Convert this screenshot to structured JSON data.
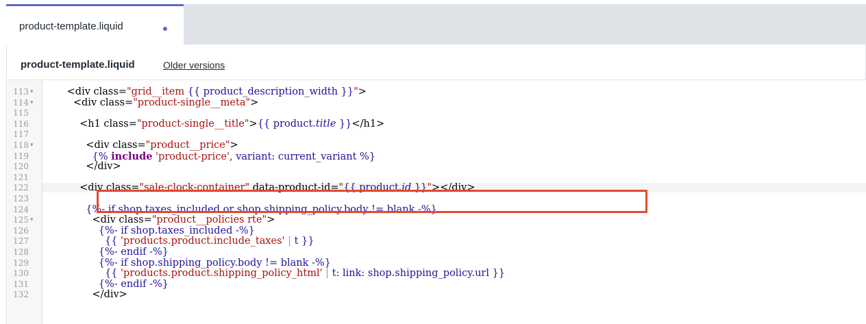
{
  "tabs": [
    {
      "label": "product-template.liquid",
      "modified": true
    }
  ],
  "file_header": {
    "file_name": "product-template.liquid",
    "older_versions_label": "Older versions"
  },
  "editor": {
    "lines": [
      {
        "n": "113",
        "fold": "▾",
        "tokens": [
          [
            "plain",
            "      <div "
          ],
          [
            "attr",
            "class="
          ],
          [
            "str",
            "\"grid__item "
          ],
          [
            "liq",
            "{{ product_description_width }}"
          ],
          [
            "str",
            "\""
          ],
          [
            "plain",
            ">"
          ]
        ]
      },
      {
        "n": "114",
        "fold": "▾",
        "tokens": [
          [
            "plain",
            "        <div "
          ],
          [
            "attr",
            "class="
          ],
          [
            "str",
            "\"product-single__meta\""
          ],
          [
            "plain",
            ">"
          ]
        ]
      },
      {
        "n": "115",
        "fold": "",
        "tokens": []
      },
      {
        "n": "116",
        "fold": "",
        "tokens": [
          [
            "plain",
            "          <h1 "
          ],
          [
            "attr",
            "class="
          ],
          [
            "str",
            "\"product-single__title\""
          ],
          [
            "plain",
            ">"
          ],
          [
            "liq",
            "{{ product."
          ],
          [
            "prop",
            "title"
          ],
          [
            "liq",
            " }}"
          ],
          [
            "plain",
            "</h1>"
          ]
        ]
      },
      {
        "n": "117",
        "fold": "",
        "tokens": []
      },
      {
        "n": "118",
        "fold": "▾",
        "tokens": [
          [
            "plain",
            "            <div "
          ],
          [
            "attr",
            "class="
          ],
          [
            "str",
            "\"product__price\""
          ],
          [
            "plain",
            ">"
          ]
        ]
      },
      {
        "n": "119",
        "fold": "",
        "tokens": [
          [
            "liq",
            "              {% "
          ],
          [
            "kw",
            "include"
          ],
          [
            "str",
            " 'product-price'"
          ],
          [
            "liq",
            ", variant: current_variant %}"
          ]
        ]
      },
      {
        "n": "120",
        "fold": "",
        "tokens": [
          [
            "plain",
            "            </div>"
          ]
        ]
      },
      {
        "n": "121",
        "fold": "",
        "tokens": []
      },
      {
        "n": "122",
        "fold": "",
        "tokens": [
          [
            "plain",
            "          <div "
          ],
          [
            "attr",
            "class="
          ],
          [
            "str",
            "\"sale-clock-container\""
          ],
          [
            "attr",
            " data-product-id="
          ],
          [
            "str",
            "\""
          ],
          [
            "liq",
            "{{ product."
          ],
          [
            "prop",
            "id"
          ],
          [
            "liq",
            " }}"
          ],
          [
            "str",
            "\""
          ],
          [
            "plain",
            "></div>"
          ]
        ]
      },
      {
        "n": "123",
        "fold": "",
        "tokens": []
      },
      {
        "n": "124",
        "fold": "",
        "tokens": [
          [
            "liq",
            "            {%- if shop.taxes_included or shop.shipping_policy.body != blank -%}"
          ]
        ]
      },
      {
        "n": "125",
        "fold": "▾",
        "tokens": [
          [
            "plain",
            "              <div "
          ],
          [
            "attr",
            "class="
          ],
          [
            "str",
            "\"product__policies rte\""
          ],
          [
            "plain",
            ">"
          ]
        ]
      },
      {
        "n": "126",
        "fold": "",
        "tokens": [
          [
            "liq",
            "                {%- if shop.taxes_included -%}"
          ]
        ]
      },
      {
        "n": "127",
        "fold": "",
        "tokens": [
          [
            "liq",
            "                  {{ "
          ],
          [
            "str",
            "'products.product.include_taxes'"
          ],
          [
            "pipe",
            " | "
          ],
          [
            "liq",
            "t }}"
          ]
        ]
      },
      {
        "n": "128",
        "fold": "",
        "tokens": [
          [
            "liq",
            "                {%- endif -%}"
          ]
        ]
      },
      {
        "n": "129",
        "fold": "",
        "tokens": [
          [
            "liq",
            "                {%- if shop.shipping_policy.body != blank -%}"
          ]
        ]
      },
      {
        "n": "130",
        "fold": "",
        "tokens": [
          [
            "liq",
            "                  {{ "
          ],
          [
            "str",
            "'products.product.shipping_policy_html'"
          ],
          [
            "pipe",
            " | "
          ],
          [
            "liq",
            "t: link: shop.shipping_policy.url }}"
          ]
        ]
      },
      {
        "n": "131",
        "fold": "",
        "tokens": [
          [
            "liq",
            "                {%- endif -%}"
          ]
        ]
      },
      {
        "n": "132",
        "fold": "",
        "tokens": [
          [
            "plain",
            "              </div>"
          ]
        ]
      }
    ]
  }
}
